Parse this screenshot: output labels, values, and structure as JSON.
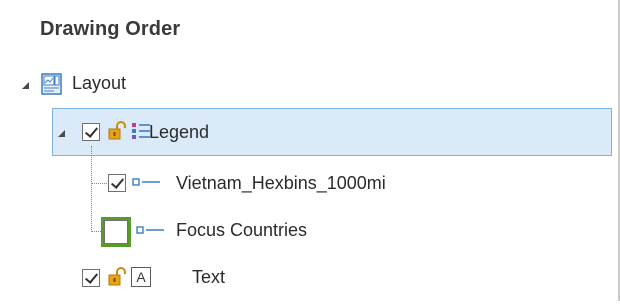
{
  "pane": {
    "title": "Drawing Order"
  },
  "tree": {
    "layout": {
      "label": "Layout",
      "expanded": true
    },
    "legend": {
      "label": "Legend",
      "checked": true,
      "expanded": true,
      "selected": true
    },
    "legend_children": [
      {
        "label": "Vietnam_Hexbins_1000mi",
        "checked": true
      },
      {
        "label": "Focus Countries",
        "checked": false,
        "highlighted": true
      }
    ],
    "text_element": {
      "label": "Text",
      "checked": true
    },
    "text_icon_glyph": "A"
  },
  "colors": {
    "selection_bg": "#dbeaf8",
    "selection_border": "#7db3e5",
    "highlight_outline": "#5a9a2a",
    "lock_icon": "#e8a317",
    "layer_line_icon": "#3b7fc4"
  }
}
